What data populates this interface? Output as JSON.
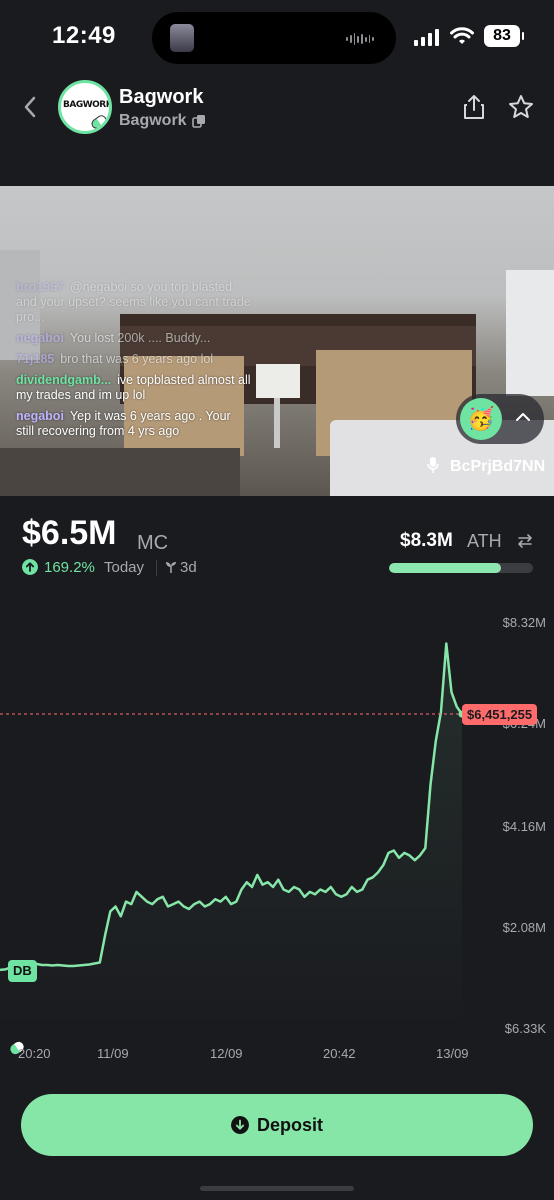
{
  "status_bar": {
    "time": "12:49",
    "battery": "83"
  },
  "header": {
    "avatar_text": "BAGWORK",
    "title": "Bagwork",
    "subtitle": "Bagwork"
  },
  "stream": {
    "chat": [
      {
        "user": "bro1957",
        "text": "@negaboi so you top blasted and your upset? seems like you cant trade pro..."
      },
      {
        "user": "negaboi",
        "text": "You lost 200k .... Buddy..."
      },
      {
        "user": "71j185",
        "text": "bro that was 6 years ago lol"
      },
      {
        "user": "dividendgamb...",
        "text": "ive topblasted almost all my trades and im up lol"
      },
      {
        "user": "negaboi",
        "text": "Yep it was 6 years ago . Your still recovering from 4 yrs ago"
      }
    ],
    "reaction_emoji": "🥳",
    "streamer": "BcPrjBd7NN"
  },
  "stats": {
    "market_cap": "$6.5M",
    "market_cap_label": "MC",
    "change": "169.2%",
    "change_period": "Today",
    "age": "3d",
    "ath_value": "$8.3M",
    "ath_label": "ATH",
    "ath_progress": 0.78
  },
  "chart_data": {
    "type": "line",
    "y_ticks": [
      "$8.32M",
      "$6.24M",
      "$4.16M",
      "$2.08M",
      "$6.33K"
    ],
    "x_ticks": [
      "20:20",
      "11/09",
      "12/09",
      "20:42",
      "13/09"
    ],
    "current_price_label": "$6,451,255",
    "current_price": 6451255,
    "start_marker": "DB",
    "ylim": [
      6330,
      8320000
    ],
    "color": "#86e6a8",
    "series": [
      {
        "values": [
          1200000,
          1210000,
          1250000,
          1280000,
          1300000,
          1320000,
          1330000,
          1320000,
          1300000,
          1300000,
          1290000,
          1300000,
          1290000,
          1280000,
          1280000,
          1290000,
          1300000,
          1310000,
          1330000,
          1350000,
          1900000,
          2400000,
          2500000,
          2300000,
          2600000,
          2550000,
          2800000,
          2700000,
          2600000,
          2550000,
          2650000,
          2700000,
          2500000,
          2550000,
          2600000,
          2500000,
          2450000,
          2550000,
          2600000,
          2500000,
          2550000,
          2650000,
          2600000,
          2700000,
          2550000,
          2600000,
          2850000,
          3000000,
          2900000,
          3150000,
          2950000,
          3000000,
          2900000,
          3050000,
          2850000,
          2800000,
          2900000,
          2850000,
          2700000,
          2800000,
          2750000,
          2850000,
          2800000,
          2900000,
          2750000,
          2700000,
          2750000,
          2900000,
          2800000,
          2850000,
          3050000,
          3100000,
          3200000,
          3350000,
          3600000,
          3650000,
          3500000,
          3600000,
          3550000,
          3450000,
          3550000,
          3700000,
          5000000,
          5900000,
          6500000,
          7900000,
          6900000,
          6600000,
          6450000
        ]
      }
    ]
  },
  "deposit": {
    "label": "Deposit"
  }
}
